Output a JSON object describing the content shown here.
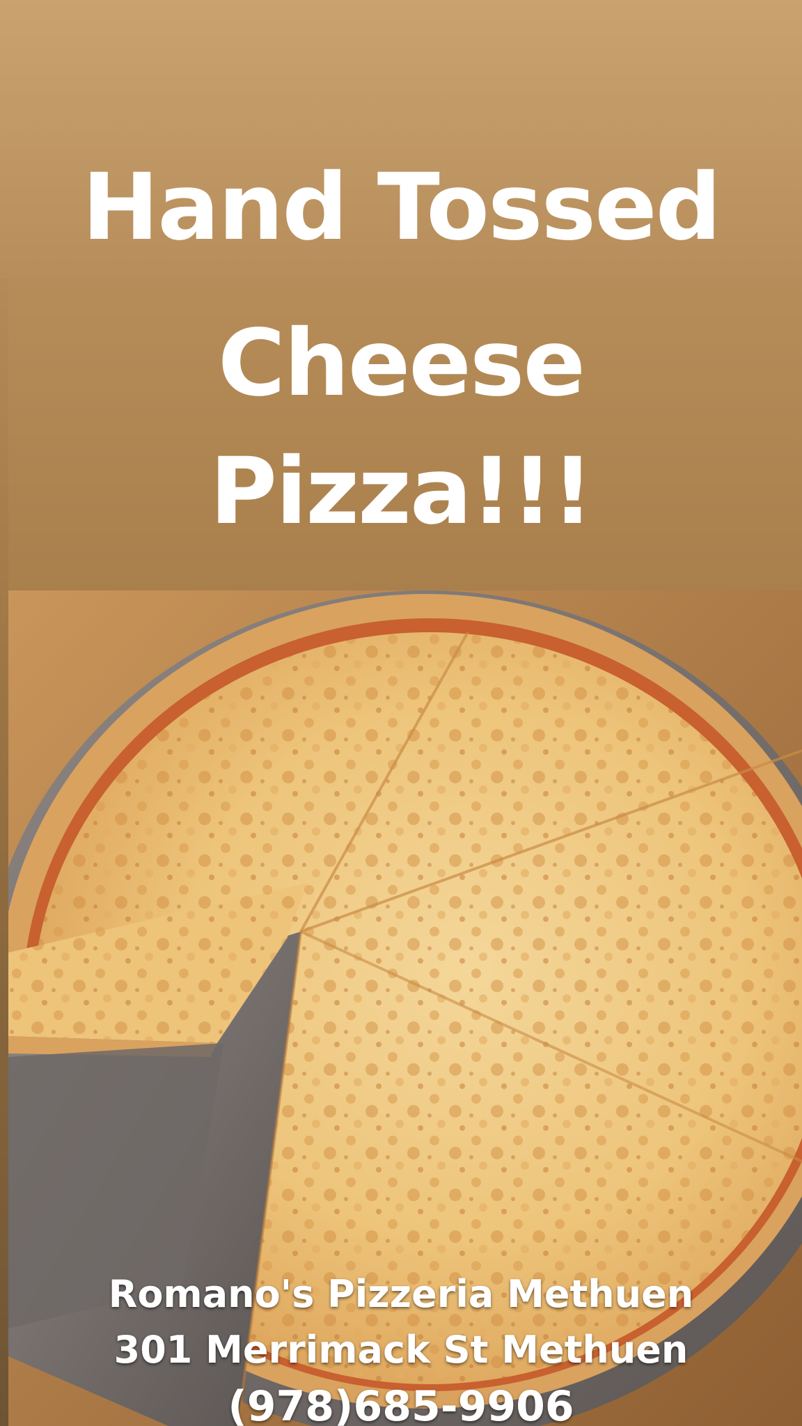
{
  "headline": {
    "line1": "Hand Tossed",
    "line2": "Cheese",
    "line3": "Pizza!!!"
  },
  "footer": {
    "business_name": "Romano's Pizzeria Methuen",
    "address": "301 Merrimack St Methuen",
    "phone": "(978)685-9906"
  },
  "colors": {
    "background_tan": "#b48b58",
    "text": "#ffffff",
    "cheese": "#f0c878",
    "crust": "#d8a05c",
    "sauce": "#c0562a",
    "pan": "#7c7572"
  }
}
